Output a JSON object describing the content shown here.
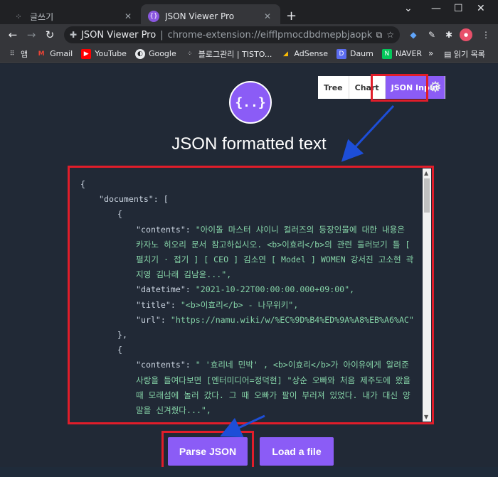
{
  "browser": {
    "tabs": [
      {
        "title": "글쓰기",
        "active": false
      },
      {
        "title": "JSON Viewer Pro",
        "active": true
      }
    ],
    "address": {
      "site": "JSON Viewer Pro",
      "url": "chrome-extension://eifflpmocdbdmepbjaopkkhbfmdgij..."
    },
    "bookmarks": [
      "앱",
      "Gmail",
      "YouTube",
      "Google",
      "블로그관리 | TISTO...",
      "AdSense",
      "Daum",
      "NAVER"
    ],
    "more": "»",
    "reading_list": "읽기 목록"
  },
  "app": {
    "logo_text": "{..}",
    "view_tabs": [
      "Tree",
      "Chart",
      "JSON Input"
    ],
    "active_tab": "JSON Input",
    "title": "JSON formatted text",
    "code_lines": [
      {
        "indent": 0,
        "text": "{"
      },
      {
        "indent": 1,
        "text": "\"documents\": ["
      },
      {
        "indent": 2,
        "text": "{"
      },
      {
        "indent": 3,
        "key": "\"contents\": ",
        "value": "\"아이돌 마스터 샤이니 컬러즈의 등장인물에 대한 내용은 카자노 히오리 문서 참고하십시오. <b>이효리</b>의 관련 둘러보기 틀 [ 펼치기 · 접기 ] [ CEO ] 김소연 [ Model ] WOMEN 강서진 고소현 곽지영 김나래 김남윤...\","
      },
      {
        "indent": 3,
        "key": "\"datetime\": ",
        "value": "\"2021-10-22T00:00:00.000+09:00\","
      },
      {
        "indent": 3,
        "key": "\"title\": ",
        "value": "\"<b>이효리</b> - 나무위키\","
      },
      {
        "indent": 3,
        "key": "\"url\": ",
        "value": "\"https://namu.wiki/w/%EC%9D%B4%ED%9A%A8%EB%A6%AC\""
      },
      {
        "indent": 2,
        "text": "},"
      },
      {
        "indent": 2,
        "text": "{"
      },
      {
        "indent": 3,
        "key": "\"contents\": ",
        "value": "\" '효리네 민박' , <b>이효리</b>가 아이유에게 알려준 사랑을 들여다보면 [엔터미디어=정덕현] \"상순 오빠와 처음 제주도에 왔을 때 모래섬에 놀러 갔다. 그 때 오빠가 팔이 부러져 있었다. 내가 대신 양말을 신겨줬다...\","
      }
    ],
    "buttons": {
      "parse": "Parse JSON",
      "load": "Load a file"
    }
  },
  "colors": {
    "accent": "#8b5cf6",
    "highlight": "#e11d2a",
    "arrow": "#1d4ed8",
    "page_bg": "#212936",
    "string": "#86d4a8"
  }
}
